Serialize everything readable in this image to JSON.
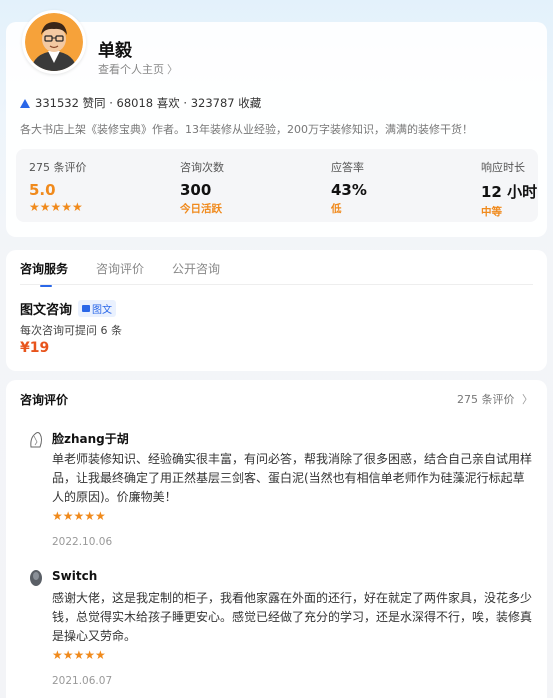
{
  "profile": {
    "name": "单毅",
    "homepage_link": "查看个人主页",
    "stats_line": "331532 赞同 · 68018 喜欢 · 323787 收藏",
    "bio": "各大书店上架《装修宝典》作者。13年装修从业经验，200万字装修知识，满满的装修干货！"
  },
  "metrics": [
    {
      "label": "275 条评价",
      "value": "5.0",
      "sub": "★★★★★"
    },
    {
      "label": "咨询次数",
      "value": "300",
      "sub": "今日活跃"
    },
    {
      "label": "应答率",
      "value": "43%",
      "sub": "低"
    },
    {
      "label": "响应时长",
      "value": "12 小时",
      "sub": "中等"
    }
  ],
  "tabs": [
    "咨询服务",
    "咨询评价",
    "公开咨询"
  ],
  "service": {
    "title": "图文咨询",
    "badge": "图文",
    "desc": "每次咨询可提问 6 条",
    "price": "¥19"
  },
  "reviews_section": {
    "title": "咨询评价",
    "count": "275 条评价"
  },
  "reviews": [
    {
      "name": "脸zhang于胡",
      "text": "单老师装修知识、经验确实很丰富，有问必答，帮我消除了很多困惑，结合自己亲自试用样品，让我最终确定了用正然基层三剑客、蛋白泥(当然也有相信单老师作为硅藻泥行标起草人的原因)。价廉物美！",
      "stars": "★★★★★",
      "date": "2022.10.06"
    },
    {
      "name": "Switch",
      "text": "感谢大佬，这是我定制的柜子，我看他家露在外面的还行，好在就定了两件家具，没花多少钱，总觉得实木给孩子睡更安心。感觉已经做了充分的学习，还是水深得不行，唉，装修真是操心又劳命。",
      "stars": "★★★★★",
      "date": "2021.06.07"
    }
  ],
  "colors": {
    "accent": "#2a67e8",
    "orange": "#f08a1c",
    "price": "#e8541c"
  }
}
